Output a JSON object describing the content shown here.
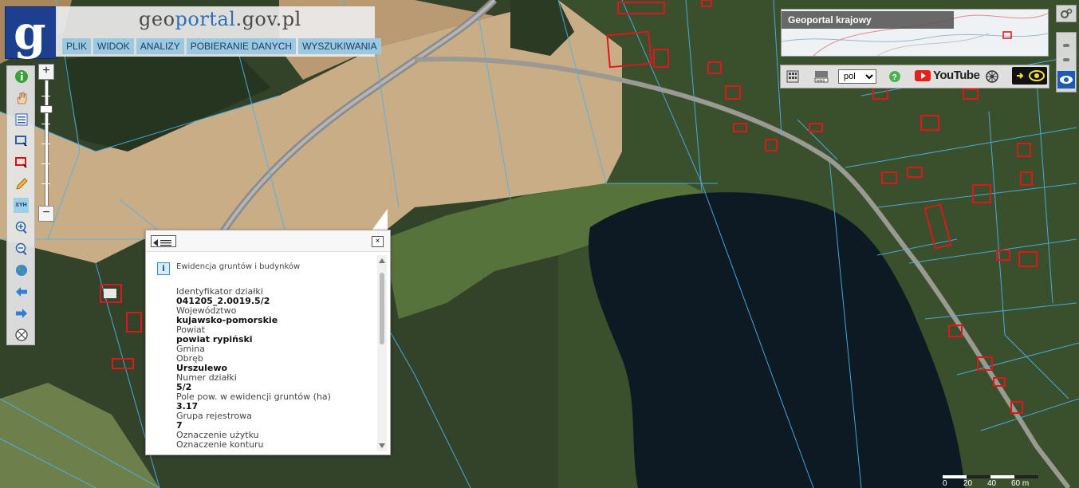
{
  "brand": {
    "logo_letter": "g",
    "title_part1": "geo",
    "title_part2": "portal",
    "title_part3": ".gov.pl"
  },
  "menu": {
    "items": [
      "PLIK",
      "WIDOK",
      "ANALIZY",
      "POBIERANIE DANYCH",
      "WYSZUKIWANIA"
    ]
  },
  "toolbar": {
    "tools": [
      "info-icon",
      "pan-hand-icon",
      "legend-icon",
      "select-rectangle-icon",
      "select-rectangle-red-icon",
      "measure-pencil-icon",
      "xyh-icon",
      "zoom-in-icon",
      "zoom-out-icon",
      "globe-icon",
      "back-arrow-icon",
      "forward-arrow-icon",
      "compass-icon"
    ],
    "xyh_label": "XYH"
  },
  "zoom": {
    "plus": "+",
    "minus": "−"
  },
  "overview": {
    "title": "Geoportal krajowy"
  },
  "right_tools": {
    "language_value": "pol",
    "youtube_label": "YouTube"
  },
  "popup": {
    "section_title": "Ewidencja gruntów i budynków",
    "info_symbol": "i",
    "fields": [
      {
        "label": "Identyfikator działki",
        "value": "041205_2.0019.5/2"
      },
      {
        "label": "Województwo",
        "value": "kujawsko-pomorskie"
      },
      {
        "label": "Powiat",
        "value": "powiat rypiński"
      },
      {
        "label": "Gmina",
        "value": ""
      },
      {
        "label": "Obręb",
        "value": "Urszulewo"
      },
      {
        "label": "Numer działki",
        "value": "5/2"
      },
      {
        "label": "Pole pow. w ewidencji gruntów (ha)",
        "value": "3.17"
      },
      {
        "label": "Grupa rejestrowa",
        "value": "7"
      },
      {
        "label": "Oznaczenie użytku",
        "value": ""
      },
      {
        "label": "Oznaczenie konturu",
        "value": ""
      }
    ],
    "close_symbol": "×"
  },
  "scale": {
    "labels": [
      "0",
      "20",
      "40",
      "60 m"
    ]
  },
  "colors": {
    "menu_bg": "#9cc9e0",
    "logo_bg": "#1c3f8f",
    "parcel_line": "#4ab3f0",
    "building_outline": "#e0161d"
  }
}
